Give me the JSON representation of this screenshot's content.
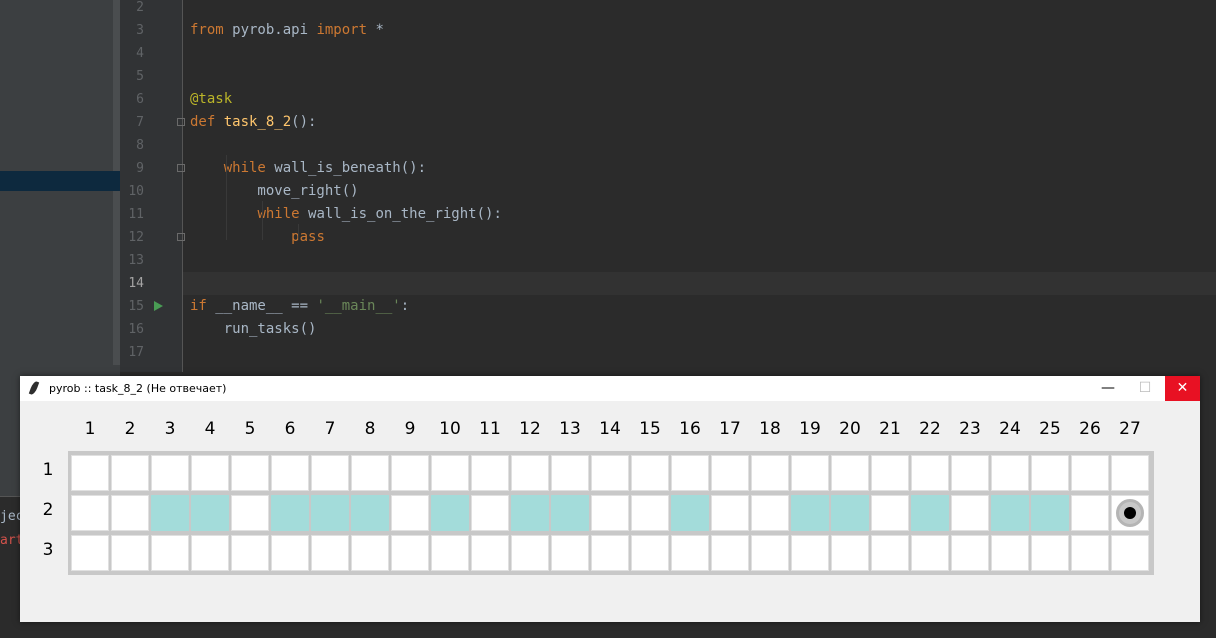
{
  "ide": {
    "bottom_lines": [
      {
        "text": "jec",
        "color": "#a9b7c6"
      },
      {
        "text": "art",
        "color": "#d2524b"
      }
    ],
    "code_lines": [
      {
        "num": "2",
        "tokens": []
      },
      {
        "num": "3",
        "tokens": [
          {
            "t": "from",
            "c": "kw"
          },
          {
            "t": " pyrob.api ",
            "c": ""
          },
          {
            "t": "import",
            "c": "kw"
          },
          {
            "t": " *",
            "c": ""
          }
        ]
      },
      {
        "num": "4",
        "tokens": []
      },
      {
        "num": "5",
        "tokens": []
      },
      {
        "num": "6",
        "tokens": [
          {
            "t": "@task",
            "c": "deco"
          }
        ]
      },
      {
        "num": "7",
        "tokens": [
          {
            "t": "def ",
            "c": "kw"
          },
          {
            "t": "task_8_2",
            "c": "fn"
          },
          {
            "t": "():",
            "c": ""
          }
        ]
      },
      {
        "num": "8",
        "tokens": []
      },
      {
        "num": "9",
        "tokens": [
          {
            "t": "    ",
            "c": ""
          },
          {
            "t": "while",
            "c": "kw"
          },
          {
            "t": " wall_is_beneath():",
            "c": ""
          }
        ]
      },
      {
        "num": "10",
        "tokens": [
          {
            "t": "        move_right()",
            "c": ""
          }
        ]
      },
      {
        "num": "11",
        "tokens": [
          {
            "t": "        ",
            "c": ""
          },
          {
            "t": "while",
            "c": "kw"
          },
          {
            "t": " wall_is_on_the_right():",
            "c": ""
          }
        ]
      },
      {
        "num": "12",
        "tokens": [
          {
            "t": "            ",
            "c": ""
          },
          {
            "t": "pass",
            "c": "kw"
          }
        ]
      },
      {
        "num": "13",
        "tokens": []
      },
      {
        "num": "14",
        "tokens": []
      },
      {
        "num": "15",
        "tokens": [
          {
            "t": "if",
            "c": "kw"
          },
          {
            "t": " __name__ == ",
            "c": ""
          },
          {
            "t": "'__main__'",
            "c": "str"
          },
          {
            "t": ":",
            "c": ""
          }
        ]
      },
      {
        "num": "16",
        "tokens": [
          {
            "t": "    run_tasks()",
            "c": ""
          }
        ]
      },
      {
        "num": "17",
        "tokens": []
      }
    ]
  },
  "window": {
    "title": "pyrob :: task_8_2 (Не отвечает)",
    "minimize_glyph": "—",
    "maximize_glyph": "☐",
    "close_glyph": "✕"
  },
  "grid": {
    "columns": [
      "1",
      "2",
      "3",
      "4",
      "5",
      "6",
      "7",
      "8",
      "9",
      "10",
      "11",
      "12",
      "13",
      "14",
      "15",
      "16",
      "17",
      "18",
      "19",
      "20",
      "21",
      "22",
      "23",
      "24",
      "25",
      "26",
      "27"
    ],
    "rows": [
      "1",
      "2",
      "3"
    ],
    "painted_cells": [
      {
        "row": 2,
        "col": 3
      },
      {
        "row": 2,
        "col": 4
      },
      {
        "row": 2,
        "col": 6
      },
      {
        "row": 2,
        "col": 7
      },
      {
        "row": 2,
        "col": 8
      },
      {
        "row": 2,
        "col": 10
      },
      {
        "row": 2,
        "col": 12
      },
      {
        "row": 2,
        "col": 13
      },
      {
        "row": 2,
        "col": 16
      },
      {
        "row": 2,
        "col": 19
      },
      {
        "row": 2,
        "col": 20
      },
      {
        "row": 2,
        "col": 22
      },
      {
        "row": 2,
        "col": 24
      },
      {
        "row": 2,
        "col": 25
      }
    ],
    "robot": {
      "row": 2,
      "col": 27
    },
    "paint_color": "#a3dcda"
  }
}
